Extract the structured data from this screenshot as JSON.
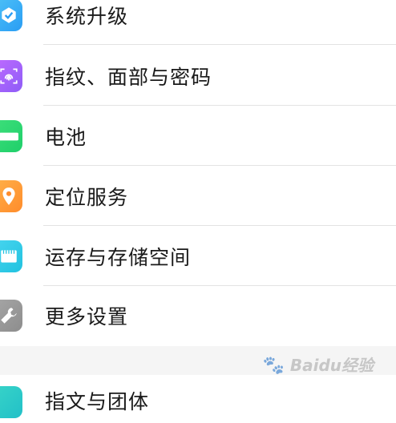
{
  "settings": {
    "items": [
      {
        "label": "系统升级",
        "icon": "system-update-icon",
        "color": "#2a9df4"
      },
      {
        "label": "指纹、面部与密码",
        "icon": "fingerprint-icon",
        "color": "#8e5cf7"
      },
      {
        "label": "电池",
        "icon": "battery-icon",
        "color": "#1fcf6a"
      },
      {
        "label": "定位服务",
        "icon": "location-pin-icon",
        "color": "#ff8c2b"
      },
      {
        "label": "运存与存储空间",
        "icon": "memory-storage-icon",
        "color": "#21c2e0"
      },
      {
        "label": "更多设置",
        "icon": "wrench-icon",
        "color": "#8d8d8d"
      }
    ],
    "next_item": {
      "label": "指文与团体",
      "icon": "partially-visible-icon"
    }
  },
  "watermark": {
    "text": "Baidu经验"
  }
}
